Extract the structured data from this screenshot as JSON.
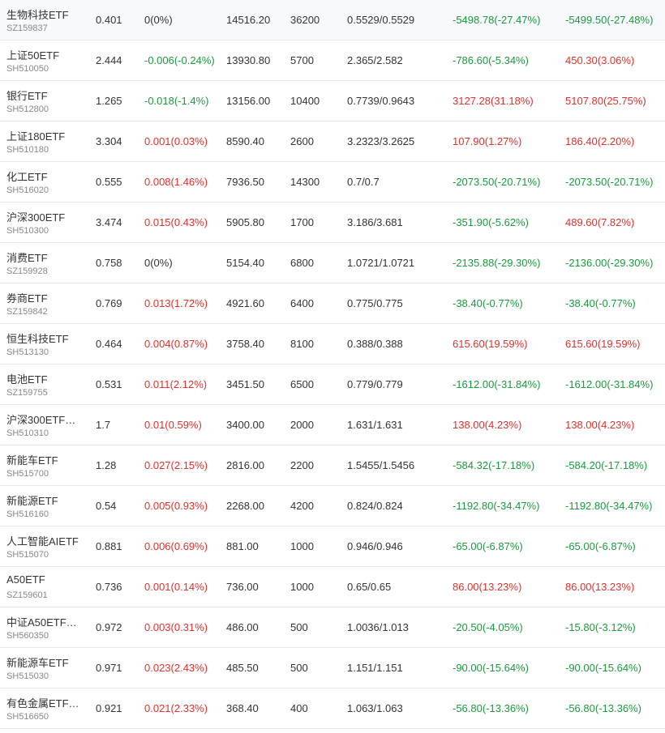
{
  "colors": {
    "up": "#e0312a",
    "down": "#1a9b3c",
    "flat": "#333333"
  },
  "rows": [
    {
      "name": "生物科技ETF",
      "code": "SZ159837",
      "price": "0.401",
      "change": "0(0%)",
      "change_dir": "flat",
      "value": "14516.20",
      "qty": "36200",
      "cost": "0.5529/0.5529",
      "pl": "-5498.78(-27.47%)",
      "pl_dir": "down",
      "pl2": "-5499.50(-27.48%)",
      "pl2_dir": "down"
    },
    {
      "name": "上证50ETF",
      "code": "SH510050",
      "price": "2.444",
      "change": "-0.006(-0.24%)",
      "change_dir": "down",
      "value": "13930.80",
      "qty": "5700",
      "cost": "2.365/2.582",
      "pl": "-786.60(-5.34%)",
      "pl_dir": "down",
      "pl2": "450.30(3.06%)",
      "pl2_dir": "up"
    },
    {
      "name": "银行ETF",
      "code": "SH512800",
      "price": "1.265",
      "change": "-0.018(-1.4%)",
      "change_dir": "down",
      "value": "13156.00",
      "qty": "10400",
      "cost": "0.7739/0.9643",
      "pl": "3127.28(31.18%)",
      "pl_dir": "up",
      "pl2": "5107.80(25.75%)",
      "pl2_dir": "up"
    },
    {
      "name": "上证180ETF",
      "code": "SH510180",
      "price": "3.304",
      "change": "0.001(0.03%)",
      "change_dir": "up",
      "value": "8590.40",
      "qty": "2600",
      "cost": "3.2323/3.2625",
      "pl": "107.90(1.27%)",
      "pl_dir": "up",
      "pl2": "186.40(2.20%)",
      "pl2_dir": "up"
    },
    {
      "name": "化工ETF",
      "code": "SH516020",
      "price": "0.555",
      "change": "0.008(1.46%)",
      "change_dir": "up",
      "value": "7936.50",
      "qty": "14300",
      "cost": "0.7/0.7",
      "pl": "-2073.50(-20.71%)",
      "pl_dir": "down",
      "pl2": "-2073.50(-20.71%)",
      "pl2_dir": "down"
    },
    {
      "name": "沪深300ETF",
      "code": "SH510300",
      "price": "3.474",
      "change": "0.015(0.43%)",
      "change_dir": "up",
      "value": "5905.80",
      "qty": "1700",
      "cost": "3.186/3.681",
      "pl": "-351.90(-5.62%)",
      "pl_dir": "down",
      "pl2": "489.60(7.82%)",
      "pl2_dir": "up"
    },
    {
      "name": "消费ETF",
      "code": "SZ159928",
      "price": "0.758",
      "change": "0(0%)",
      "change_dir": "flat",
      "value": "5154.40",
      "qty": "6800",
      "cost": "1.0721/1.0721",
      "pl": "-2135.88(-29.30%)",
      "pl_dir": "down",
      "pl2": "-2136.00(-29.30%)",
      "pl2_dir": "down"
    },
    {
      "name": "券商ETF",
      "code": "SZ159842",
      "price": "0.769",
      "change": "0.013(1.72%)",
      "change_dir": "up",
      "value": "4921.60",
      "qty": "6400",
      "cost": "0.775/0.775",
      "pl": "-38.40(-0.77%)",
      "pl_dir": "down",
      "pl2": "-38.40(-0.77%)",
      "pl2_dir": "down"
    },
    {
      "name": "恒生科技ETF",
      "code": "SH513130",
      "price": "0.464",
      "change": "0.004(0.87%)",
      "change_dir": "up",
      "value": "3758.40",
      "qty": "8100",
      "cost": "0.388/0.388",
      "pl": "615.60(19.59%)",
      "pl_dir": "up",
      "pl2": "615.60(19.59%)",
      "pl2_dir": "up"
    },
    {
      "name": "电池ETF",
      "code": "SZ159755",
      "price": "0.531",
      "change": "0.011(2.12%)",
      "change_dir": "up",
      "value": "3451.50",
      "qty": "6500",
      "cost": "0.779/0.779",
      "pl": "-1612.00(-31.84%)",
      "pl_dir": "down",
      "pl2": "-1612.00(-31.84%)",
      "pl2_dir": "down"
    },
    {
      "name": "沪深300ETF…",
      "code": "SH510310",
      "price": "1.7",
      "change": "0.01(0.59%)",
      "change_dir": "up",
      "value": "3400.00",
      "qty": "2000",
      "cost": "1.631/1.631",
      "pl": "138.00(4.23%)",
      "pl_dir": "up",
      "pl2": "138.00(4.23%)",
      "pl2_dir": "up"
    },
    {
      "name": "新能车ETF",
      "code": "SH515700",
      "price": "1.28",
      "change": "0.027(2.15%)",
      "change_dir": "up",
      "value": "2816.00",
      "qty": "2200",
      "cost": "1.5455/1.5456",
      "pl": "-584.32(-17.18%)",
      "pl_dir": "down",
      "pl2": "-584.20(-17.18%)",
      "pl2_dir": "down"
    },
    {
      "name": "新能源ETF",
      "code": "SH516160",
      "price": "0.54",
      "change": "0.005(0.93%)",
      "change_dir": "up",
      "value": "2268.00",
      "qty": "4200",
      "cost": "0.824/0.824",
      "pl": "-1192.80(-34.47%)",
      "pl_dir": "down",
      "pl2": "-1192.80(-34.47%)",
      "pl2_dir": "down"
    },
    {
      "name": "人工智能AIETF",
      "code": "SH515070",
      "price": "0.881",
      "change": "0.006(0.69%)",
      "change_dir": "up",
      "value": "881.00",
      "qty": "1000",
      "cost": "0.946/0.946",
      "pl": "-65.00(-6.87%)",
      "pl_dir": "down",
      "pl2": "-65.00(-6.87%)",
      "pl2_dir": "down"
    },
    {
      "name": "A50ETF",
      "code": "SZ159601",
      "price": "0.736",
      "change": "0.001(0.14%)",
      "change_dir": "up",
      "value": "736.00",
      "qty": "1000",
      "cost": "0.65/0.65",
      "pl": "86.00(13.23%)",
      "pl_dir": "up",
      "pl2": "86.00(13.23%)",
      "pl2_dir": "up"
    },
    {
      "name": "中证A50ETF…",
      "code": "SH560350",
      "price": "0.972",
      "change": "0.003(0.31%)",
      "change_dir": "up",
      "value": "486.00",
      "qty": "500",
      "cost": "1.0036/1.013",
      "pl": "-20.50(-4.05%)",
      "pl_dir": "down",
      "pl2": "-15.80(-3.12%)",
      "pl2_dir": "down"
    },
    {
      "name": "新能源车ETF",
      "code": "SH515030",
      "price": "0.971",
      "change": "0.023(2.43%)",
      "change_dir": "up",
      "value": "485.50",
      "qty": "500",
      "cost": "1.151/1.151",
      "pl": "-90.00(-15.64%)",
      "pl_dir": "down",
      "pl2": "-90.00(-15.64%)",
      "pl2_dir": "down"
    },
    {
      "name": "有色金属ETF…",
      "code": "SH516650",
      "price": "0.921",
      "change": "0.021(2.33%)",
      "change_dir": "up",
      "value": "368.40",
      "qty": "400",
      "cost": "1.063/1.063",
      "pl": "-56.80(-13.36%)",
      "pl_dir": "down",
      "pl2": "-56.80(-13.36%)",
      "pl2_dir": "down"
    }
  ]
}
